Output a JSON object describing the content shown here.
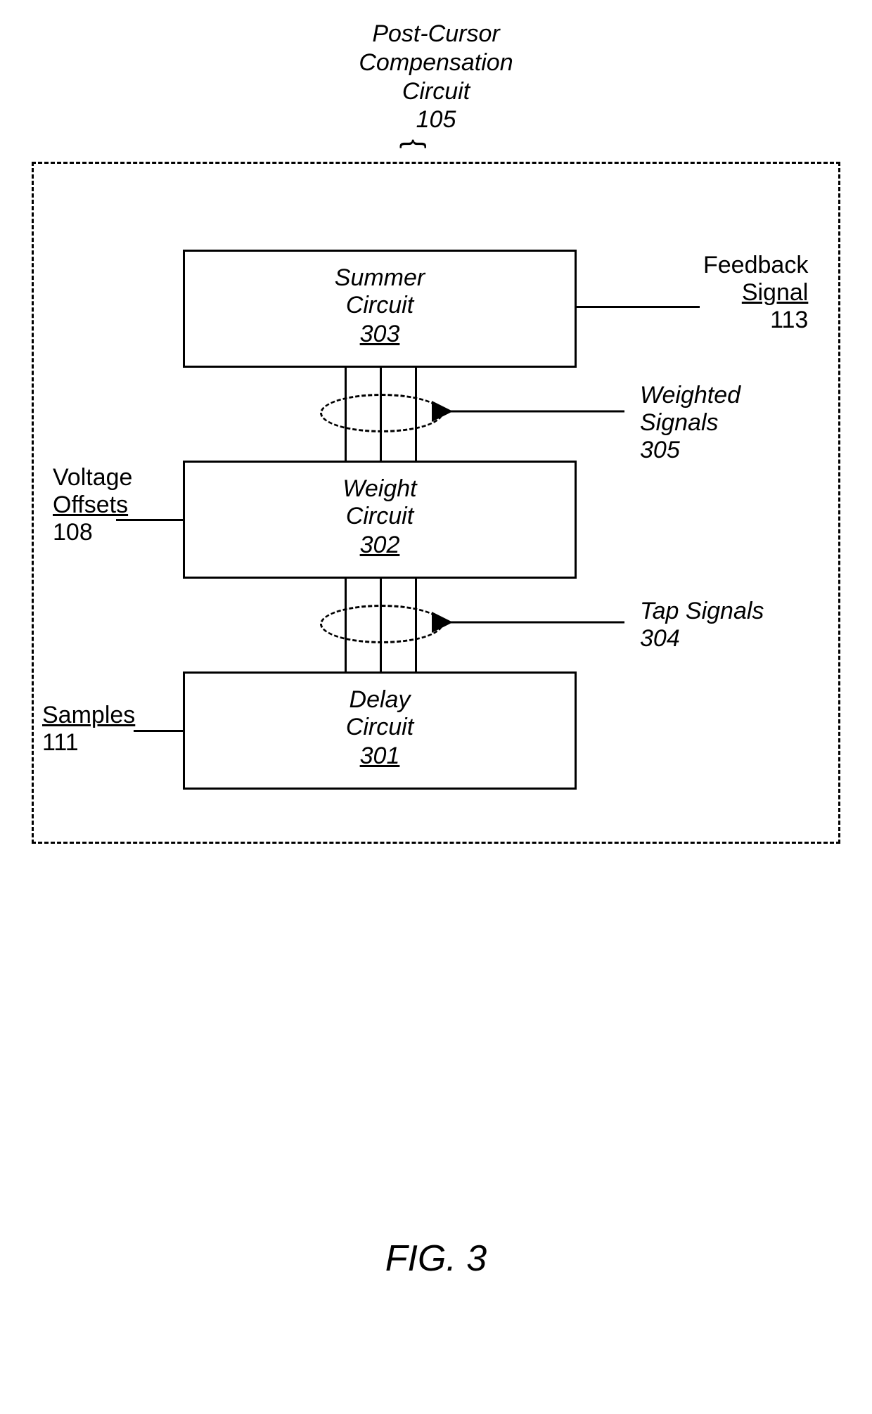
{
  "title": {
    "line1": "Post-Cursor",
    "line2": "Compensation",
    "line3": "Circuit",
    "num": "105"
  },
  "blocks": {
    "summer": {
      "line1": "Summer",
      "line2": "Circuit",
      "num": "303"
    },
    "weight": {
      "line1": "Weight",
      "line2": "Circuit",
      "num": "302"
    },
    "delay": {
      "line1": "Delay",
      "line2": "Circuit",
      "num": "301"
    }
  },
  "labels": {
    "feedback": {
      "line1": "Feedback",
      "line2": "Signal",
      "num": "113"
    },
    "voltage": {
      "line1": "Voltage",
      "line2": "Offsets",
      "num": "108"
    },
    "samples": {
      "line1": "Samples",
      "num": "111"
    },
    "weighted": {
      "line1": "Weighted",
      "line2": "Signals",
      "num": "305"
    },
    "tap": {
      "line1": "Tap Signals",
      "num": "304"
    }
  },
  "figure_caption": "FIG. 3"
}
